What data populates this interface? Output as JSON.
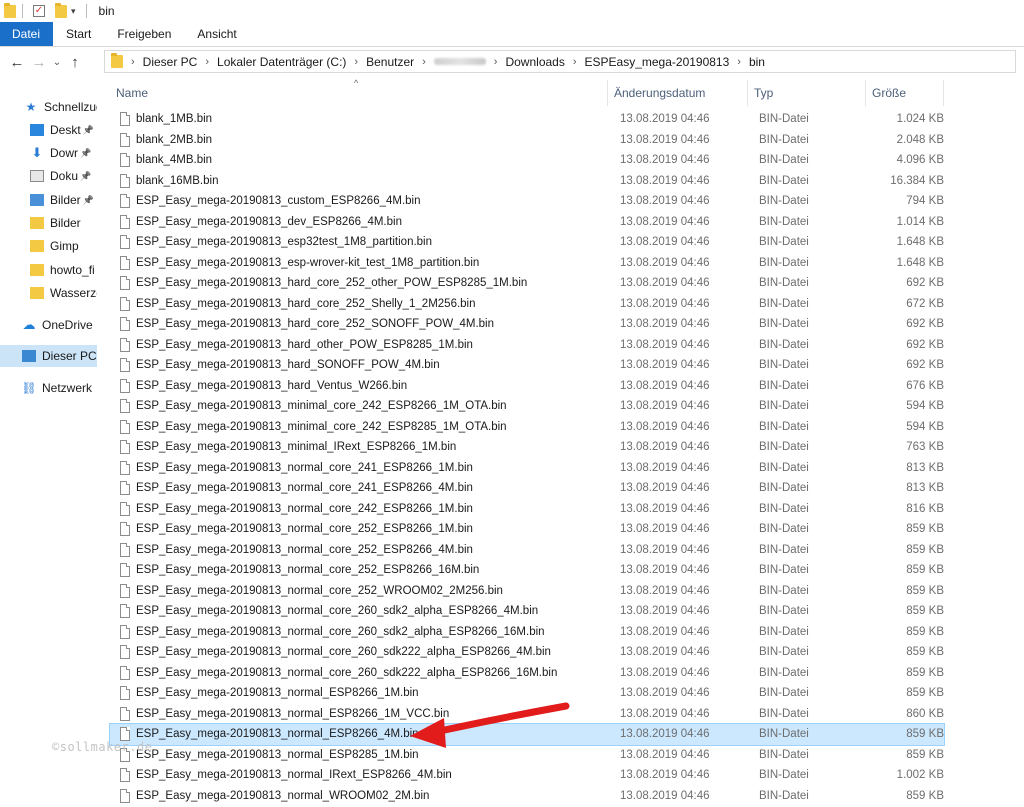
{
  "window": {
    "title": "bin"
  },
  "ribbon": {
    "tabs": [
      "Datei",
      "Start",
      "Freigeben",
      "Ansicht"
    ]
  },
  "address": {
    "crumbs": [
      "Dieser PC",
      "Lokaler Datenträger (C:)",
      "Benutzer",
      "",
      "Downloads",
      "ESPEasy_mega-20190813",
      "bin"
    ]
  },
  "sidebar": {
    "items": [
      {
        "label": "Schnellzug",
        "icon": "star-icon",
        "pinned": false
      },
      {
        "label": "Deskt",
        "icon": "desktop-icon",
        "pinned": true
      },
      {
        "label": "Dowr",
        "icon": "download-icon",
        "pinned": true
      },
      {
        "label": "Doku",
        "icon": "document-icon",
        "pinned": true
      },
      {
        "label": "Bilder",
        "icon": "pictures-icon",
        "pinned": true
      },
      {
        "label": "Bilder",
        "icon": "folder-icon",
        "pinned": false
      },
      {
        "label": "Gimp",
        "icon": "folder-icon",
        "pinned": false
      },
      {
        "label": "howto_fi",
        "icon": "folder-icon",
        "pinned": false
      },
      {
        "label": "Wasserze",
        "icon": "folder-icon",
        "pinned": false
      },
      {
        "label": "OneDrive",
        "icon": "cloud-icon",
        "pinned": false
      },
      {
        "label": "Dieser PC",
        "icon": "computer-icon",
        "pinned": false
      },
      {
        "label": "Netzwerk",
        "icon": "network-icon",
        "pinned": false
      }
    ]
  },
  "columns": {
    "name": "Name",
    "date": "Änderungsdatum",
    "type": "Typ",
    "size": "Größe"
  },
  "files": [
    {
      "name": "blank_1MB.bin",
      "date": "13.08.2019 04:46",
      "type": "BIN-Datei",
      "size": "1.024 KB"
    },
    {
      "name": "blank_2MB.bin",
      "date": "13.08.2019 04:46",
      "type": "BIN-Datei",
      "size": "2.048 KB"
    },
    {
      "name": "blank_4MB.bin",
      "date": "13.08.2019 04:46",
      "type": "BIN-Datei",
      "size": "4.096 KB"
    },
    {
      "name": "blank_16MB.bin",
      "date": "13.08.2019 04:46",
      "type": "BIN-Datei",
      "size": "16.384 KB"
    },
    {
      "name": "ESP_Easy_mega-20190813_custom_ESP8266_4M.bin",
      "date": "13.08.2019 04:46",
      "type": "BIN-Datei",
      "size": "794 KB"
    },
    {
      "name": "ESP_Easy_mega-20190813_dev_ESP8266_4M.bin",
      "date": "13.08.2019 04:46",
      "type": "BIN-Datei",
      "size": "1.014 KB"
    },
    {
      "name": "ESP_Easy_mega-20190813_esp32test_1M8_partition.bin",
      "date": "13.08.2019 04:46",
      "type": "BIN-Datei",
      "size": "1.648 KB"
    },
    {
      "name": "ESP_Easy_mega-20190813_esp-wrover-kit_test_1M8_partition.bin",
      "date": "13.08.2019 04:46",
      "type": "BIN-Datei",
      "size": "1.648 KB"
    },
    {
      "name": "ESP_Easy_mega-20190813_hard_core_252_other_POW_ESP8285_1M.bin",
      "date": "13.08.2019 04:46",
      "type": "BIN-Datei",
      "size": "692 KB"
    },
    {
      "name": "ESP_Easy_mega-20190813_hard_core_252_Shelly_1_2M256.bin",
      "date": "13.08.2019 04:46",
      "type": "BIN-Datei",
      "size": "672 KB"
    },
    {
      "name": "ESP_Easy_mega-20190813_hard_core_252_SONOFF_POW_4M.bin",
      "date": "13.08.2019 04:46",
      "type": "BIN-Datei",
      "size": "692 KB"
    },
    {
      "name": "ESP_Easy_mega-20190813_hard_other_POW_ESP8285_1M.bin",
      "date": "13.08.2019 04:46",
      "type": "BIN-Datei",
      "size": "692 KB"
    },
    {
      "name": "ESP_Easy_mega-20190813_hard_SONOFF_POW_4M.bin",
      "date": "13.08.2019 04:46",
      "type": "BIN-Datei",
      "size": "692 KB"
    },
    {
      "name": "ESP_Easy_mega-20190813_hard_Ventus_W266.bin",
      "date": "13.08.2019 04:46",
      "type": "BIN-Datei",
      "size": "676 KB"
    },
    {
      "name": "ESP_Easy_mega-20190813_minimal_core_242_ESP8266_1M_OTA.bin",
      "date": "13.08.2019 04:46",
      "type": "BIN-Datei",
      "size": "594 KB"
    },
    {
      "name": "ESP_Easy_mega-20190813_minimal_core_242_ESP8285_1M_OTA.bin",
      "date": "13.08.2019 04:46",
      "type": "BIN-Datei",
      "size": "594 KB"
    },
    {
      "name": "ESP_Easy_mega-20190813_minimal_IRext_ESP8266_1M.bin",
      "date": "13.08.2019 04:46",
      "type": "BIN-Datei",
      "size": "763 KB"
    },
    {
      "name": "ESP_Easy_mega-20190813_normal_core_241_ESP8266_1M.bin",
      "date": "13.08.2019 04:46",
      "type": "BIN-Datei",
      "size": "813 KB"
    },
    {
      "name": "ESP_Easy_mega-20190813_normal_core_241_ESP8266_4M.bin",
      "date": "13.08.2019 04:46",
      "type": "BIN-Datei",
      "size": "813 KB"
    },
    {
      "name": "ESP_Easy_mega-20190813_normal_core_242_ESP8266_1M.bin",
      "date": "13.08.2019 04:46",
      "type": "BIN-Datei",
      "size": "816 KB"
    },
    {
      "name": "ESP_Easy_mega-20190813_normal_core_252_ESP8266_1M.bin",
      "date": "13.08.2019 04:46",
      "type": "BIN-Datei",
      "size": "859 KB"
    },
    {
      "name": "ESP_Easy_mega-20190813_normal_core_252_ESP8266_4M.bin",
      "date": "13.08.2019 04:46",
      "type": "BIN-Datei",
      "size": "859 KB"
    },
    {
      "name": "ESP_Easy_mega-20190813_normal_core_252_ESP8266_16M.bin",
      "date": "13.08.2019 04:46",
      "type": "BIN-Datei",
      "size": "859 KB"
    },
    {
      "name": "ESP_Easy_mega-20190813_normal_core_252_WROOM02_2M256.bin",
      "date": "13.08.2019 04:46",
      "type": "BIN-Datei",
      "size": "859 KB"
    },
    {
      "name": "ESP_Easy_mega-20190813_normal_core_260_sdk2_alpha_ESP8266_4M.bin",
      "date": "13.08.2019 04:46",
      "type": "BIN-Datei",
      "size": "859 KB"
    },
    {
      "name": "ESP_Easy_mega-20190813_normal_core_260_sdk2_alpha_ESP8266_16M.bin",
      "date": "13.08.2019 04:46",
      "type": "BIN-Datei",
      "size": "859 KB"
    },
    {
      "name": "ESP_Easy_mega-20190813_normal_core_260_sdk222_alpha_ESP8266_4M.bin",
      "date": "13.08.2019 04:46",
      "type": "BIN-Datei",
      "size": "859 KB"
    },
    {
      "name": "ESP_Easy_mega-20190813_normal_core_260_sdk222_alpha_ESP8266_16M.bin",
      "date": "13.08.2019 04:46",
      "type": "BIN-Datei",
      "size": "859 KB"
    },
    {
      "name": "ESP_Easy_mega-20190813_normal_ESP8266_1M.bin",
      "date": "13.08.2019 04:46",
      "type": "BIN-Datei",
      "size": "859 KB"
    },
    {
      "name": "ESP_Easy_mega-20190813_normal_ESP8266_1M_VCC.bin",
      "date": "13.08.2019 04:46",
      "type": "BIN-Datei",
      "size": "860 KB"
    },
    {
      "name": "ESP_Easy_mega-20190813_normal_ESP8266_4M.bin",
      "date": "13.08.2019 04:46",
      "type": "BIN-Datei",
      "size": "859 KB",
      "selected": true
    },
    {
      "name": "ESP_Easy_mega-20190813_normal_ESP8285_1M.bin",
      "date": "13.08.2019 04:46",
      "type": "BIN-Datei",
      "size": "859 KB"
    },
    {
      "name": "ESP_Easy_mega-20190813_normal_IRext_ESP8266_4M.bin",
      "date": "13.08.2019 04:46",
      "type": "BIN-Datei",
      "size": "1.002 KB"
    },
    {
      "name": "ESP_Easy_mega-20190813_normal_WROOM02_2M.bin",
      "date": "13.08.2019 04:46",
      "type": "BIN-Datei",
      "size": "859 KB"
    }
  ],
  "watermark": "©sollmaker.de",
  "colors": {
    "ribbon_file_tab": "#1a6fc9",
    "selection": "#cce8ff",
    "annotation_arrow": "#e21b1b"
  }
}
